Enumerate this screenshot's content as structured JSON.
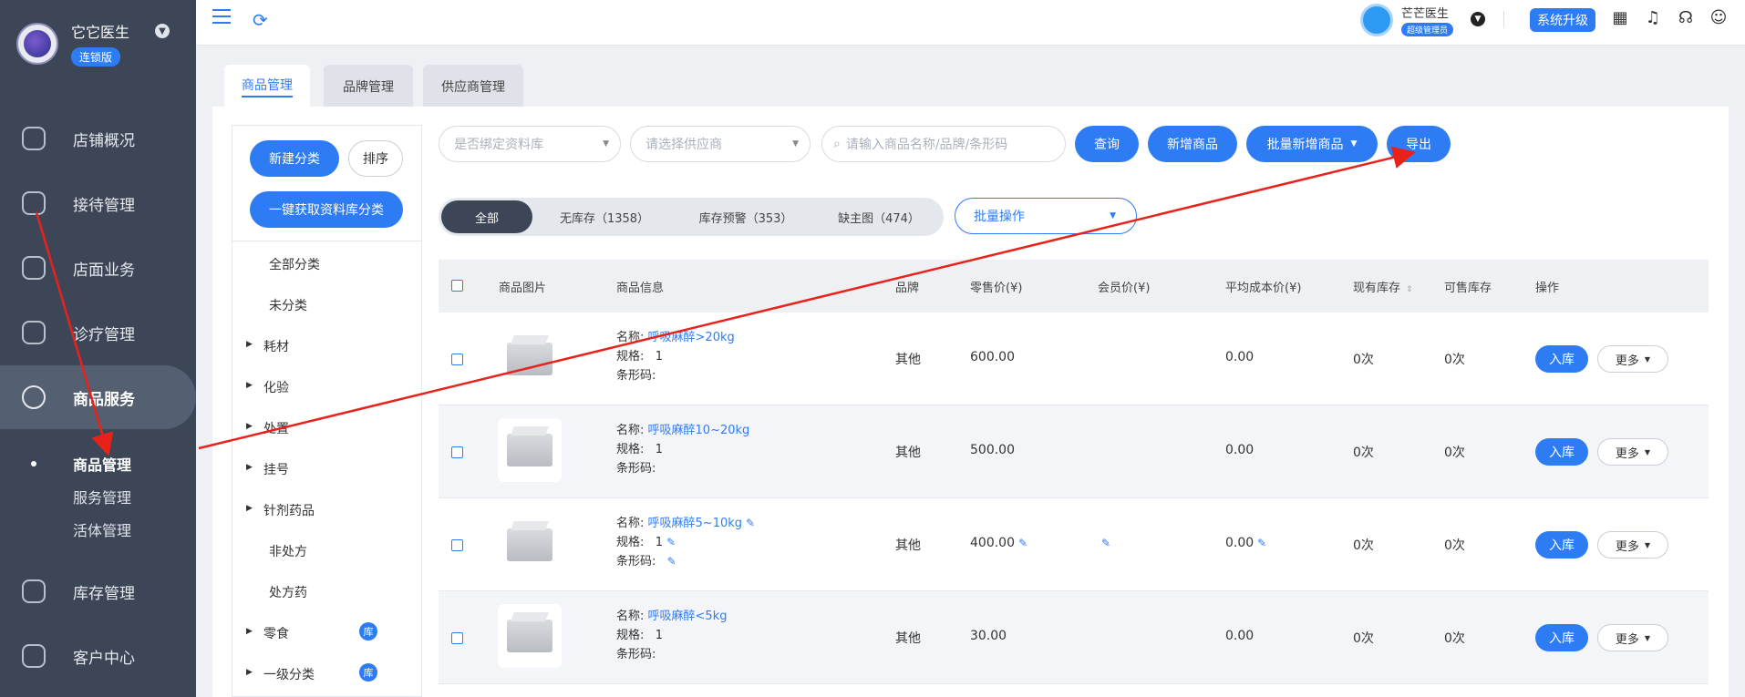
{
  "sidebar": {
    "clinic_name": "它它医生",
    "edition_badge": "连锁版",
    "nav": [
      {
        "label": "店铺概况"
      },
      {
        "label": "接待管理"
      },
      {
        "label": "店面业务"
      },
      {
        "label": "诊疗管理"
      },
      {
        "label": "商品服务"
      },
      {
        "label": "库存管理"
      },
      {
        "label": "客户中心"
      }
    ],
    "sub_items": [
      {
        "label": "商品管理"
      },
      {
        "label": "服务管理"
      },
      {
        "label": "活体管理"
      }
    ]
  },
  "topbar": {
    "user_name": "芒芒医生",
    "user_role": "超级管理员",
    "upgrade_label": "系统升级"
  },
  "tabs": [
    {
      "label": "商品管理"
    },
    {
      "label": "品牌管理"
    },
    {
      "label": "供应商管理"
    }
  ],
  "categories": {
    "new_label": "新建分类",
    "sort_label": "排序",
    "fetch_label": "一键获取资料库分类",
    "items": [
      {
        "label": "全部分类"
      },
      {
        "label": "未分类"
      },
      {
        "label": "耗材"
      },
      {
        "label": "化验"
      },
      {
        "label": "处置"
      },
      {
        "label": "挂号"
      },
      {
        "label": "针剂药品"
      },
      {
        "label": "非处方"
      },
      {
        "label": "处方药"
      },
      {
        "label": "零食"
      },
      {
        "label": "一级分类"
      }
    ],
    "ku_badge": "库"
  },
  "filters": {
    "bind_placeholder": "是否绑定资料库",
    "supplier_placeholder": "请选择供应商",
    "search_placeholder": "请输入商品名称/品牌/条形码",
    "query_label": "查询",
    "add_label": "新增商品",
    "bulk_add_label": "批量新增商品",
    "export_label": "导出"
  },
  "segments": [
    {
      "label": "全部"
    },
    {
      "label": "无库存（1358）"
    },
    {
      "label": "库存预警（353）"
    },
    {
      "label": "缺主图（474）"
    }
  ],
  "batch_label": "批量操作",
  "table": {
    "headers": [
      "商品图片",
      "商品信息",
      "品牌",
      "零售价(¥)",
      "会员价(¥)",
      "平均成本价(¥)",
      "现有库存",
      "可售库存",
      "操作"
    ],
    "name_prefix": "名称:",
    "spec_prefix": "规格:",
    "barcode_prefix": "条形码:",
    "in_label": "入库",
    "more_label": "更多",
    "rows": [
      {
        "name": "呼吸麻醉>20kg",
        "spec": "1",
        "brand": "其他",
        "retail": "600.00",
        "cost": "0.00",
        "stock": "0次",
        "sellable": "0次"
      },
      {
        "name": "呼吸麻醉10~20kg",
        "spec": "1",
        "brand": "其他",
        "retail": "500.00",
        "cost": "0.00",
        "stock": "0次",
        "sellable": "0次"
      },
      {
        "name": "呼吸麻醉5~10kg",
        "spec": "1",
        "brand": "其他",
        "retail": "400.00",
        "cost": "0.00",
        "stock": "0次",
        "sellable": "0次"
      },
      {
        "name": "呼吸麻醉<5kg",
        "spec": "1",
        "brand": "其他",
        "retail": "30.00",
        "cost": "0.00",
        "stock": "0次",
        "sellable": "0次"
      }
    ]
  },
  "colors": {
    "accent": "#2d7cf4",
    "sidebar": "#3c4656",
    "annotation": "#e8221b"
  }
}
